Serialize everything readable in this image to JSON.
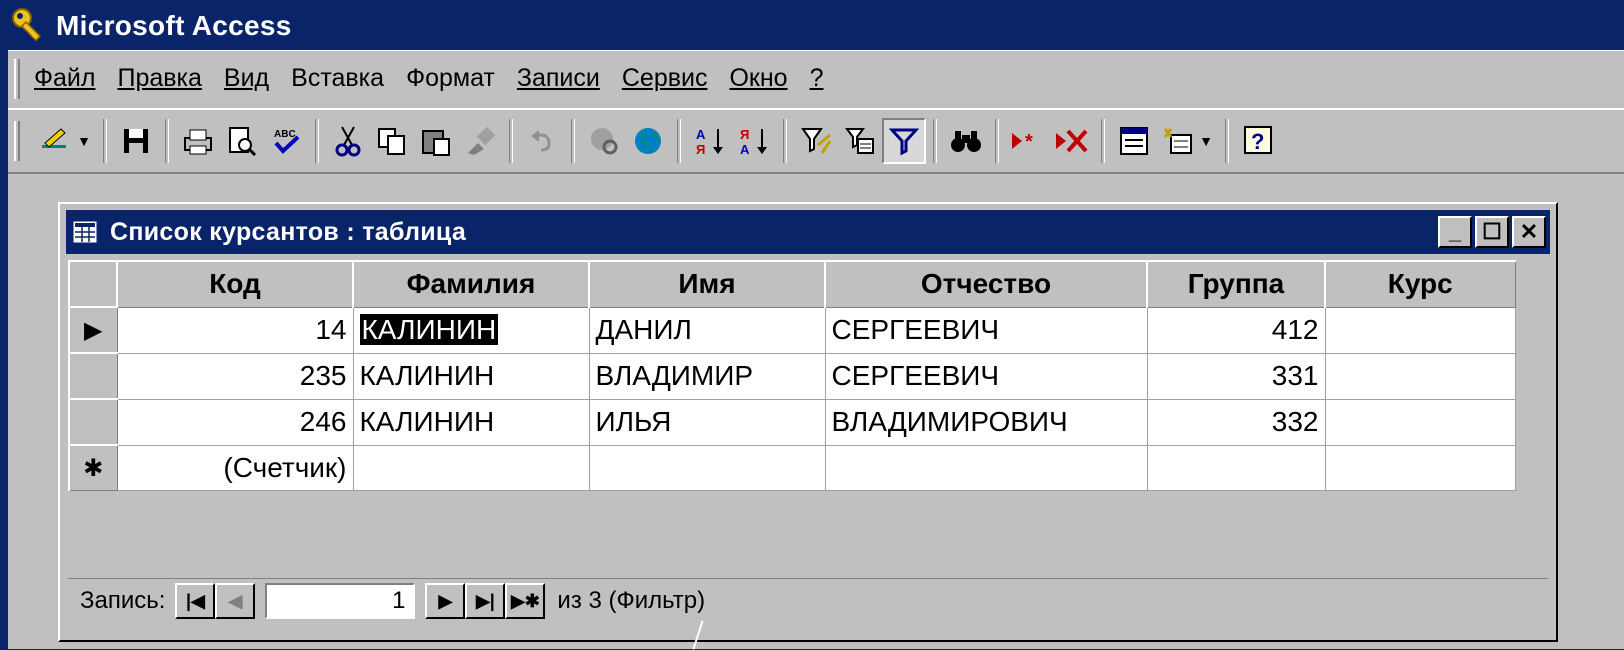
{
  "app": {
    "title": "Microsoft Access",
    "icon": "key-icon"
  },
  "menu": [
    {
      "label": "Файл"
    },
    {
      "label": "Правка"
    },
    {
      "label": "Вид"
    },
    {
      "label": "Вставка"
    },
    {
      "label": "Формат"
    },
    {
      "label": "Записи"
    },
    {
      "label": "Сервис"
    },
    {
      "label": "Окно"
    },
    {
      "label": "?"
    }
  ],
  "toolbar": {
    "icons": [
      "design-view-icon",
      "save-icon",
      "print-icon",
      "print-preview-icon",
      "spelling-icon",
      "cut-icon",
      "copy-icon",
      "paste-icon",
      "format-painter-icon",
      "undo-icon",
      "hyperlink-icon",
      "web-toolbar-icon",
      "sort-ascending-icon",
      "sort-descending-icon",
      "filter-by-selection-icon",
      "filter-by-form-icon",
      "apply-filter-icon",
      "find-icon",
      "new-record-icon",
      "delete-record-icon",
      "properties-icon",
      "new-object-icon",
      "help-icon"
    ]
  },
  "table_window": {
    "title": "Список курсантов : таблица",
    "columns": [
      "Код",
      "Фамилия",
      "Имя",
      "Отчество",
      "Группа",
      "Курс"
    ],
    "rows": [
      {
        "selector": "▶",
        "code": "14",
        "surname": "КАЛИНИН",
        "name": "ДАНИЛ",
        "patronymic": "СЕРГЕЕВИЧ",
        "group": "412",
        "course": ""
      },
      {
        "selector": "",
        "code": "235",
        "surname": "КАЛИНИН",
        "name": "ВЛАДИМИР",
        "patronymic": "СЕРГЕЕВИЧ",
        "group": "331",
        "course": ""
      },
      {
        "selector": "",
        "code": "246",
        "surname": "КАЛИНИН",
        "name": "ИЛЬЯ",
        "patronymic": "ВЛАДИМИРОВИЧ",
        "group": "332",
        "course": ""
      }
    ],
    "new_row": {
      "selector": "✱",
      "code": "(Счетчик)"
    }
  },
  "navigation": {
    "label": "Запись:",
    "current": "1",
    "total_text": "из  3 (Фильтр)"
  },
  "colors": {
    "title_bar": "#0a246a",
    "chrome": "#c0c0c0"
  }
}
